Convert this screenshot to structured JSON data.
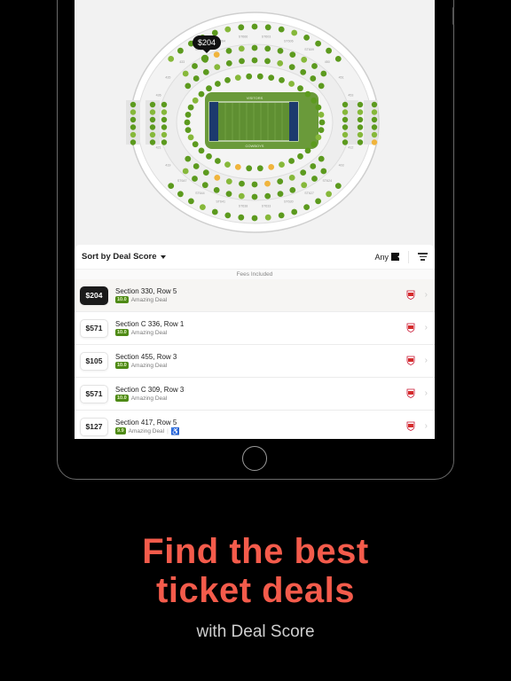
{
  "map": {
    "selected_price": "$204",
    "field_labels": {
      "top": "VISITORS",
      "bottom": "COWBOYS"
    },
    "section_labels_top": [
      "436",
      "435",
      "433",
      "ST662",
      "ST664",
      "ST666",
      "ST603",
      "ST606",
      "ST609",
      "450",
      "451",
      "453"
    ],
    "section_labels_bottom": [
      "421",
      "419",
      "ST647",
      "ST644",
      "ST641",
      "ST638",
      "ST633",
      "ST630",
      "ST627",
      "ST624",
      "403",
      "412"
    ],
    "colors": {
      "available": "#5c9a1e",
      "available_light": "#86b83a",
      "highlight": "#f0b43c",
      "field": "#5f8f32",
      "endzone": "#1c3a6e"
    }
  },
  "toolbar": {
    "sort_label": "Sort by Deal Score",
    "quantity_label": "Any",
    "fees_note": "Fees Included"
  },
  "listings": [
    {
      "price": "$204",
      "section": "Section 330, Row 5",
      "score": "10.0",
      "deal_label": "Amazing Deal",
      "accessible": false,
      "selected": true
    },
    {
      "price": "$571",
      "section": "Section C 336, Row 1",
      "score": "10.0",
      "deal_label": "Amazing Deal",
      "accessible": false,
      "selected": false
    },
    {
      "price": "$105",
      "section": "Section 455, Row 3",
      "score": "10.0",
      "deal_label": "Amazing Deal",
      "accessible": false,
      "selected": false
    },
    {
      "price": "$571",
      "section": "Section C 309, Row 3",
      "score": "10.0",
      "deal_label": "Amazing Deal",
      "accessible": false,
      "selected": false
    },
    {
      "price": "$127",
      "section": "Section 417, Row 5",
      "score": "9.9",
      "deal_label": "Amazing Deal",
      "accessible": true,
      "selected": false
    }
  ],
  "promo": {
    "headline_line1": "Find the best",
    "headline_line2": "ticket deals",
    "subtitle": "with Deal Score",
    "accent_color": "#f45b4b"
  }
}
